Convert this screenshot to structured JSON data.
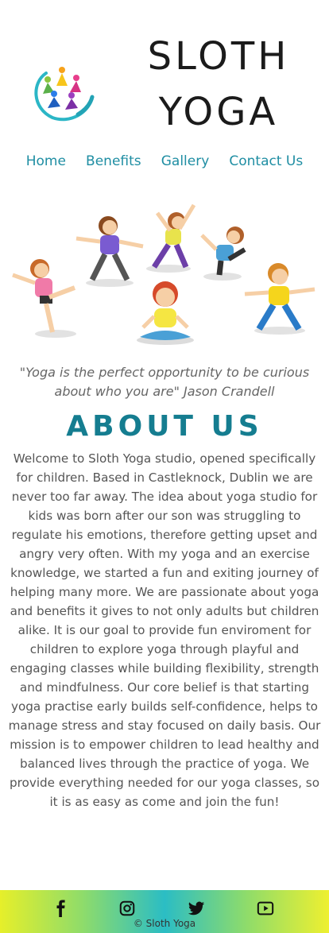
{
  "brand": {
    "line1": "SLOTH",
    "line2": "YOGA"
  },
  "nav": [
    {
      "label": "Home"
    },
    {
      "label": "Benefits"
    },
    {
      "label": "Gallery"
    },
    {
      "label": "Contact Us"
    }
  ],
  "quote": "\"Yoga is the perfect opportunity to be curious about who you are\" Jason Crandell",
  "about": {
    "title": "ABOUT US",
    "text": "Welcome to Sloth Yoga studio, opened specifically for children. Based in Castleknock, Dublin we are never too far away. The idea about yoga studio for kids was born after our son was struggling to regulate his emotions, therefore getting upset and angry very often. With my yoga and an exercise knowledge, we started a fun and exiting journey of helping many more. We are passionate about yoga and benefits it gives to not only adults but children alike. It is our goal to provide fun enviroment for children to explore yoga through playful and engaging classes while building flexibility, strength and mindfulness. Our core belief is that starting yoga practise early builds self-confidence, helps to manage stress and stay focused on daily basis. Our mission is to empower children to lead healthy and balanced lives through the practice of yoga. We provide everything needed for our yoga classes, so it is as easy as come and join the fun!"
  },
  "footer": {
    "copyright": "© Sloth Yoga",
    "social": [
      "facebook-icon",
      "instagram-icon",
      "twitter-icon",
      "youtube-icon"
    ]
  },
  "colors": {
    "accent": "#1f8ea3",
    "title": "#157d90"
  }
}
